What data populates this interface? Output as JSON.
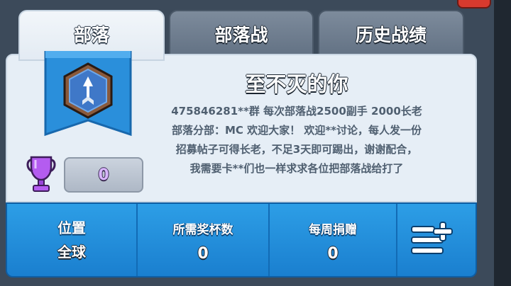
{
  "tabs": [
    {
      "label": "部落",
      "active": true
    },
    {
      "label": "部落战",
      "active": false
    },
    {
      "label": "历史战绩",
      "active": false
    }
  ],
  "clan": {
    "name": "至不灭的你",
    "description_lines": [
      "475846281**群 每次部落战2500副手 2000长老",
      "部落分部：MC 欢迎大家！ 欢迎**讨论，每人发一份",
      "招募帖子可得长老，不足3天即可踢出，谢谢配合，",
      "我需要卡**们也一样求求各位把部落战给打了"
    ],
    "trophies": "0"
  },
  "stats": {
    "location_label": "位置",
    "location_value": "全球",
    "required_trophies_label": "所需奖杯数",
    "required_trophies_value": "0",
    "weekly_donations_label": "每周捐赠",
    "weekly_donations_value": "0"
  },
  "icons": {
    "badge": "clan-shield-arrow-icon",
    "trophy": "trophy-icon",
    "menu": "list-add-icon"
  },
  "colors": {
    "stats_bar": "#1a7fcf",
    "panel": "#e6eef6",
    "banner": "#2a8fdb"
  }
}
